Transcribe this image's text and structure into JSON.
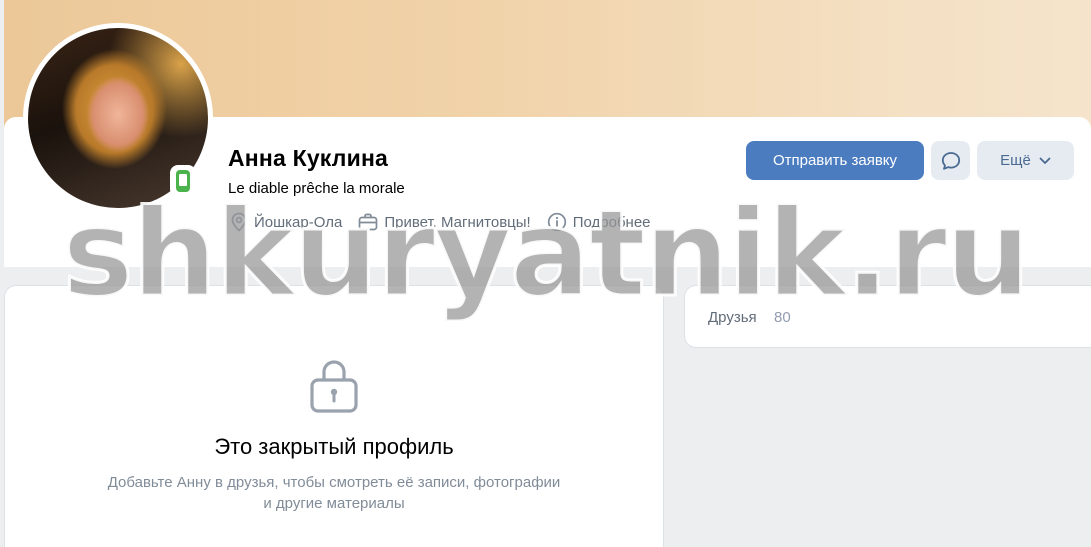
{
  "profile": {
    "name": "Анна Куклина",
    "status": "Le diable prêche la morale",
    "meta": {
      "city": "Йошкар-Ола",
      "work": "Привет, Магнитовцы!",
      "more": "Подробнее"
    },
    "online_icon": "mobile-online-icon"
  },
  "actions": {
    "add_friend": "Отправить заявку",
    "message_icon": "message-bubble-icon",
    "more": "Ещё"
  },
  "private": {
    "title": "Это закрытый профиль",
    "hint": "Добавьте Анну в друзья, чтобы смотреть её записи, фотографии и другие материалы",
    "icon": "lock-icon"
  },
  "friends": {
    "label": "Друзья",
    "count": "80"
  },
  "watermark": "shkuryatnik.ru",
  "colors": {
    "primary_button": "#4a7cbf",
    "secondary_button": "#e5ebf1",
    "online": "#4bb34b",
    "muted_text": "#818c99"
  }
}
